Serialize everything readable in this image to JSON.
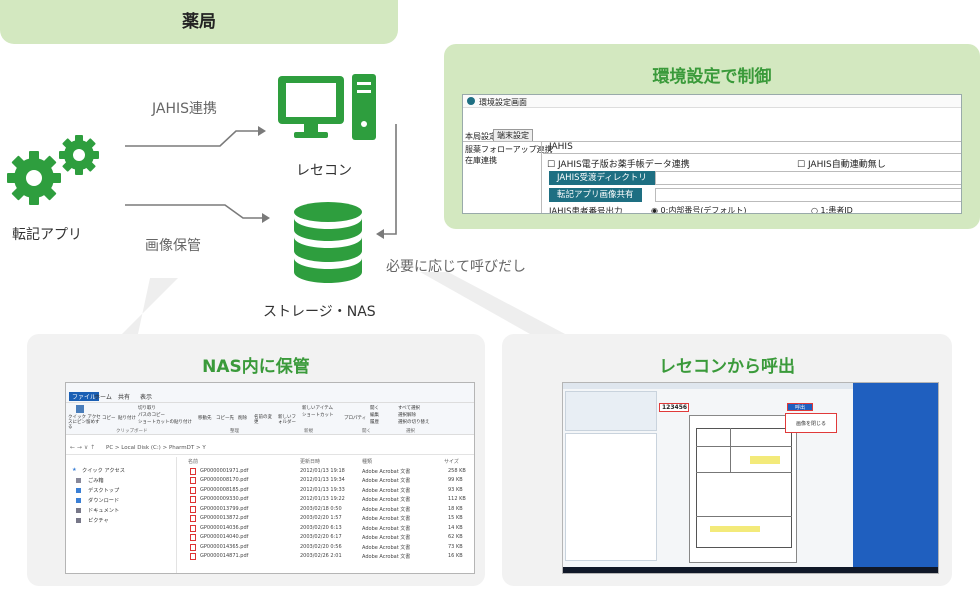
{
  "header": {
    "title": "薬局"
  },
  "nodes": {
    "app": {
      "label": "転記アプリ"
    },
    "recon": {
      "label": "レセコン"
    },
    "storage": {
      "label": "ストレージ・NAS"
    }
  },
  "edges": {
    "jahis": {
      "label": "JAHIS連携"
    },
    "image": {
      "label": "画像保管"
    },
    "call": {
      "label": "必要に応じて呼びだし"
    }
  },
  "colors": {
    "green": "#3a9a3a",
    "icon_green": "#2e9e3e",
    "light_green": "#d3e8c0",
    "panel_gray": "#f2f2f2"
  },
  "env_panel": {
    "title": "環境設定で制御",
    "screen": {
      "window_title": "環境設定画面",
      "tabs": [
        "本局設定",
        "端末設定"
      ],
      "side_items": [
        "服薬フォローアップ連携",
        "在庫連携"
      ],
      "section": "JAHIS",
      "checkbox_1": "JAHIS電子版お薬手帳データ連携",
      "checkbox_2": "JAHIS自動連動無し",
      "button_1": "JAHIS受渡ディレクトリ",
      "button_2": "転記アプリ画像共有",
      "radio_label": "JAHIS患者番号出力",
      "radio_1": "0:内部番号(デフォルト)",
      "radio_2": "1:患者ID"
    }
  },
  "nas_panel": {
    "title": "NAS内に保管",
    "explorer": {
      "tabs": [
        "ファイル",
        "ホーム",
        "共有",
        "表示"
      ],
      "ribbon": {
        "pin": "クイック アクセスにピン留めする",
        "copy": "コピー",
        "paste": "貼り付け",
        "cut": "切り取り",
        "copy_path": "パスのコピー",
        "shortcut_paste": "ショートカットの貼り付け",
        "move_to": "移動先",
        "copy_to": "コピー先",
        "delete": "削除",
        "rename": "名前の変更",
        "new_folder": "新しいフォルダー",
        "new_item": "新しいアイテム",
        "easy_access": "ショートカット",
        "properties": "プロパティ",
        "open": "開く",
        "edit": "編集",
        "history": "履歴",
        "select_all": "すべて選択",
        "select_none": "選択解除",
        "invert": "選択の切り替え",
        "group_clipboard": "クリップボード",
        "group_organize": "整理",
        "group_new": "新規",
        "group_open": "開く",
        "group_select": "選択"
      },
      "path": [
        "PC",
        "Local Disk (C:)",
        "PharmDT",
        "Y"
      ],
      "sidebar": [
        "クイック アクセス",
        "ごみ箱",
        "デスクトップ",
        "ダウンロード",
        "ドキュメント",
        "ピクチャ"
      ],
      "columns": [
        "名前",
        "更新日時",
        "種類",
        "サイズ"
      ],
      "files": [
        {
          "name": "GP0000001971.pdf",
          "date": "2012/01/13 19:18",
          "type": "Adobe Acrobat 文書",
          "size": "258 KB"
        },
        {
          "name": "GP0000008170.pdf",
          "date": "2012/01/13 19:34",
          "type": "Adobe Acrobat 文書",
          "size": "99 KB"
        },
        {
          "name": "GP0000008185.pdf",
          "date": "2012/01/13 19:33",
          "type": "Adobe Acrobat 文書",
          "size": "93 KB"
        },
        {
          "name": "GP0000009330.pdf",
          "date": "2012/01/13 19:22",
          "type": "Adobe Acrobat 文書",
          "size": "112 KB"
        },
        {
          "name": "GP0000013799.pdf",
          "date": "2003/02/18 0:50",
          "type": "Adobe Acrobat 文書",
          "size": "18 KB"
        },
        {
          "name": "GP0000013872.pdf",
          "date": "2003/02/20 1:57",
          "type": "Adobe Acrobat 文書",
          "size": "15 KB"
        },
        {
          "name": "GP0000014036.pdf",
          "date": "2003/02/20 6:13",
          "type": "Adobe Acrobat 文書",
          "size": "14 KB"
        },
        {
          "name": "GP0000014040.pdf",
          "date": "2003/02/20 6:17",
          "type": "Adobe Acrobat 文書",
          "size": "62 KB"
        },
        {
          "name": "GP0000014365.pdf",
          "date": "2003/02/20 0:56",
          "type": "Adobe Acrobat 文書",
          "size": "73 KB"
        },
        {
          "name": "GP0000014871.pdf",
          "date": "2003/02/26 2:01",
          "type": "Adobe Acrobat 文書",
          "size": "16 KB"
        }
      ]
    }
  },
  "recon_panel": {
    "title": "レセコンから呼出",
    "screen": {
      "patient_no": "123456",
      "call_button": "呼出",
      "close_image": "画像を閉じる"
    }
  }
}
